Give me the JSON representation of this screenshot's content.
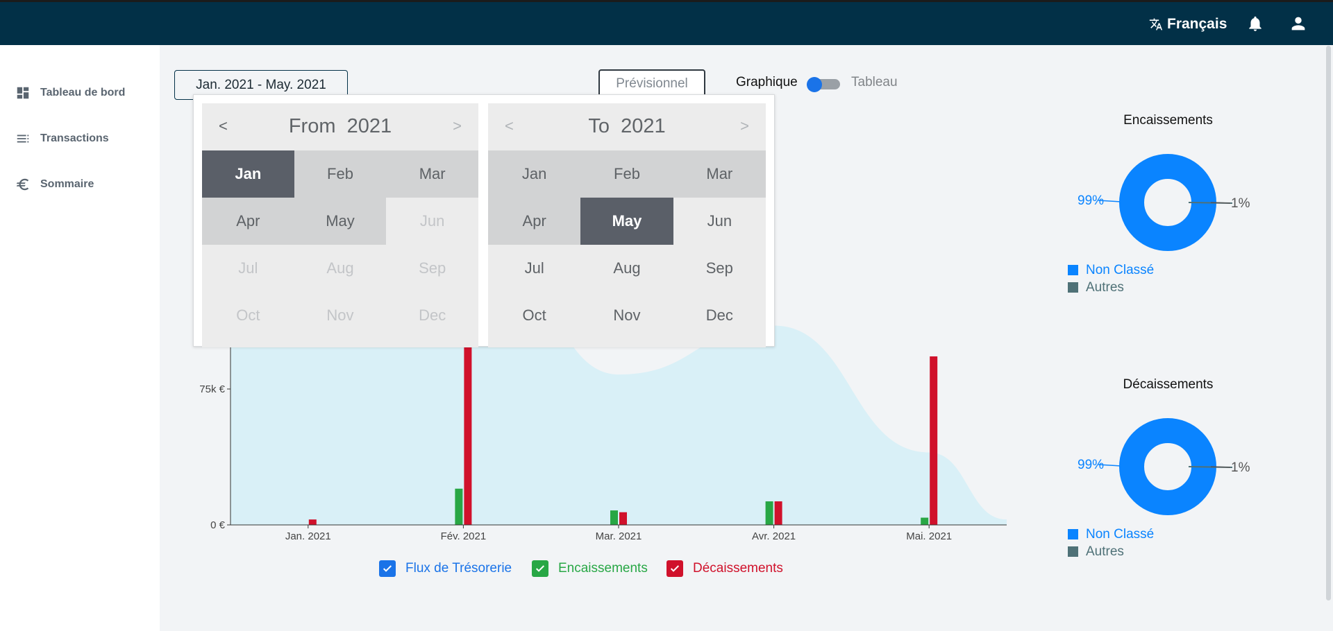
{
  "topbar": {
    "language": "Français",
    "icons": [
      "translate-icon",
      "bell-icon",
      "user-icon"
    ]
  },
  "sidebar": {
    "items": [
      {
        "label": "Tableau de bord",
        "icon": "dashboard-icon"
      },
      {
        "label": "Transactions",
        "icon": "list-icon"
      },
      {
        "label": "Sommaire",
        "icon": "euro-icon"
      }
    ]
  },
  "toolbar": {
    "date_range": "Jan. 2021 - May. 2021",
    "forecast_label": "Prévisionnel",
    "view_graph_label": "Graphique",
    "view_table_label": "Tableau"
  },
  "picker": {
    "from": {
      "label": "From",
      "year": "2021",
      "prev": "<",
      "next": ">",
      "selected": "Jan"
    },
    "to": {
      "label": "To",
      "year": "2021",
      "prev": "<",
      "next": ">",
      "selected": "May"
    },
    "months": [
      "Jan",
      "Feb",
      "Mar",
      "Apr",
      "May",
      "Jun",
      "Jul",
      "Aug",
      "Sep",
      "Oct",
      "Nov",
      "Dec"
    ]
  },
  "chart_data": {
    "type": "bar",
    "categories": [
      "Jan. 2021",
      "Fév. 2021",
      "Mar. 2021",
      "Avr. 2021",
      "Mai. 2021"
    ],
    "y_tick_labels": [
      "0 €",
      "75k €"
    ],
    "ylim": [
      0,
      150000
    ],
    "series": [
      {
        "name": "Flux de Trésorerie",
        "type": "area",
        "values": [
          null,
          185000,
          83000,
          110000,
          40000
        ]
      },
      {
        "name": "Encaissements",
        "type": "bar",
        "values": [
          0,
          20000,
          8000,
          13000,
          4000
        ]
      },
      {
        "name": "Décaissements",
        "type": "bar",
        "values": [
          3000,
          290000,
          7000,
          13000,
          93000
        ]
      }
    ],
    "colors": {
      "flux": "#1a73e8",
      "encaissements": "#28a745",
      "decaissements": "#d0112b",
      "area": "#d9f0f7"
    }
  },
  "legend": [
    {
      "label": "Flux de Trésorerie",
      "color": "#1a73e8"
    },
    {
      "label": "Encaissements",
      "color": "#28a745"
    },
    {
      "label": "Décaissements",
      "color": "#d0112b"
    }
  ],
  "donuts": [
    {
      "title": "Encaissements",
      "slices": [
        {
          "name": "Non Classé",
          "percent": 99,
          "label": "99%",
          "color": "#0a84ff"
        },
        {
          "name": "Autres",
          "percent": 1,
          "label": "1%",
          "color": "#4f7177"
        }
      ]
    },
    {
      "title": "Décaissements",
      "slices": [
        {
          "name": "Non Classé",
          "percent": 99,
          "label": "99%",
          "color": "#0a84ff"
        },
        {
          "name": "Autres",
          "percent": 1,
          "label": "1%",
          "color": "#4f7177"
        }
      ]
    }
  ]
}
